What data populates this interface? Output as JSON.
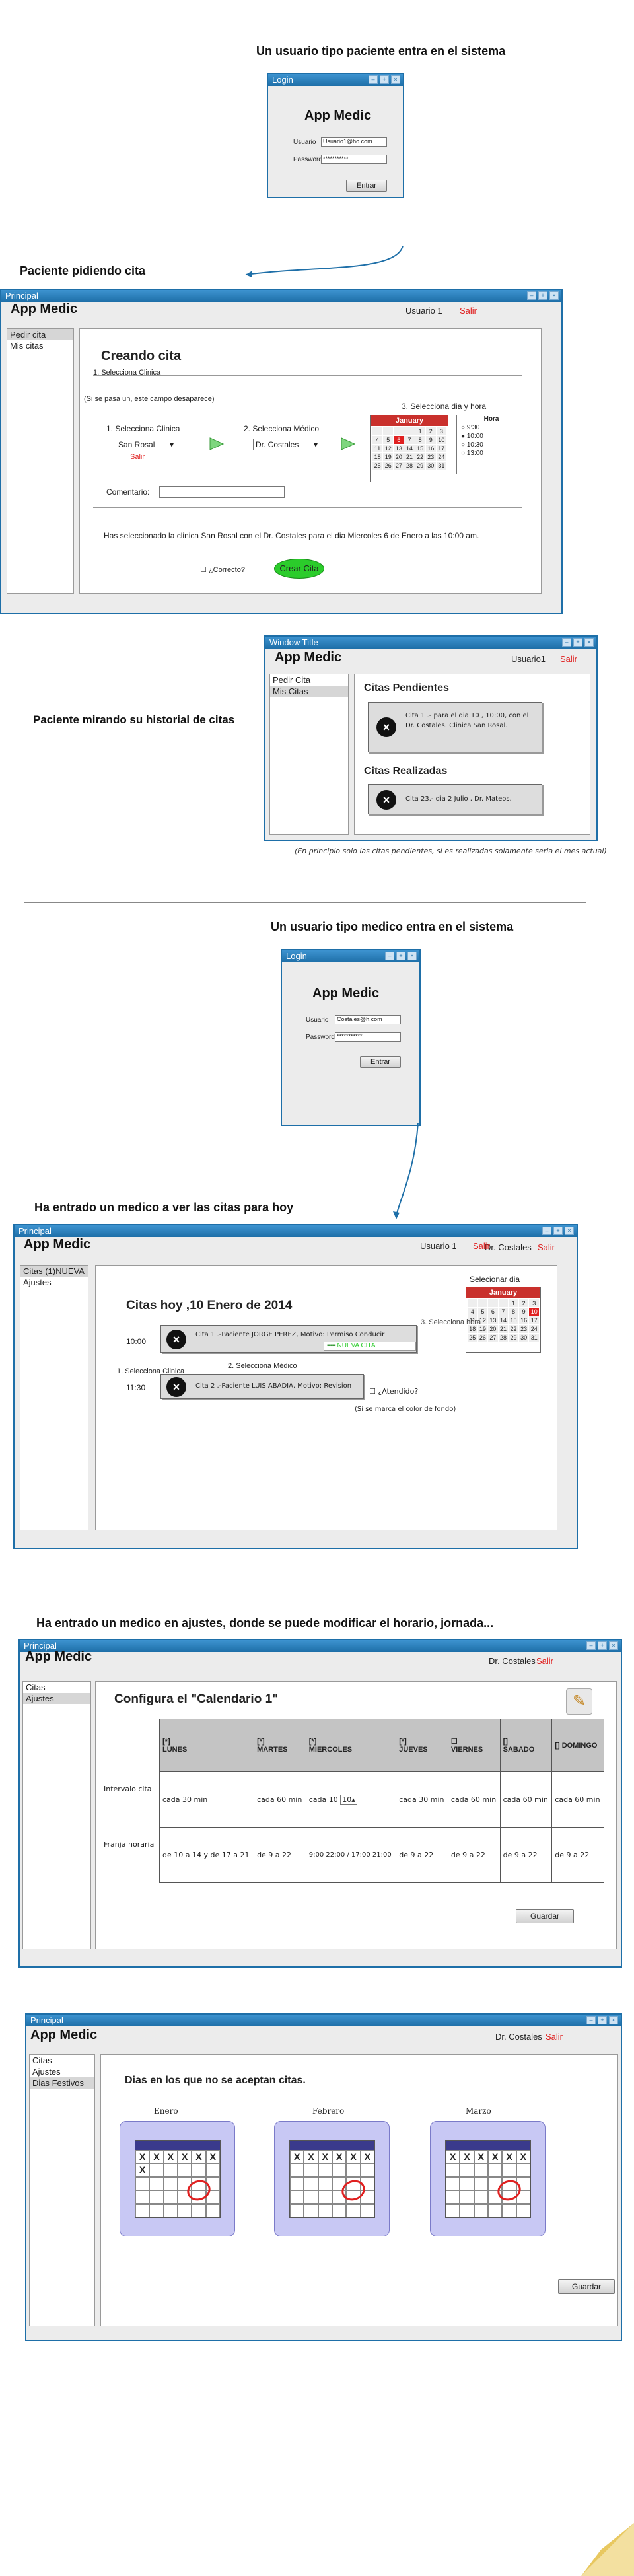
{
  "section1": {
    "heading": "Un usuario tipo paciente entra en el sistema",
    "login": {
      "title": "Login",
      "app": "App Medic",
      "user_label": "Usuario",
      "user_value": "Usuario1@ho.com",
      "pass_label": "Password",
      "pass_value": "***********",
      "button": "Entrar"
    }
  },
  "section2": {
    "heading": "Paciente pidiendo cita",
    "window_title": "Principal",
    "app": "App Medic",
    "user": "Usuario 1",
    "salir": "Salir",
    "sidebar": [
      "Pedir cita",
      "Mis citas"
    ],
    "panel_title": "Creando cita",
    "tab_label": "1. Selecciona Clinica",
    "hint": "(Si se pasa un, este campo desaparece)",
    "step1": "1. Selecciona Clinica",
    "step1_value": "San Rosal",
    "step1_note": "Salir",
    "step2": "2. Selecciona Médico",
    "step2_value": "Dr. Costales",
    "step3": "3. Selecciona dia y hora",
    "calendar_month": "January",
    "hours_header": "Hora",
    "hours": [
      "9:30",
      "10:00",
      "10:30",
      "13:00"
    ],
    "comment_label": "Comentario:",
    "summary": "Has seleccionado la clinica San Rosal con el Dr. Costales para el dia Miercoles 6 de Enero a las 10:00 am.",
    "confirm": "¿Correcto?",
    "create_button": "Crear Cita"
  },
  "section3": {
    "heading": "Paciente mirando su historial de citas",
    "window_title": "Window Title",
    "app": "App Medic",
    "user": "Usuario1",
    "salir": "Salir",
    "sidebar": [
      "Pedir Cita",
      "Mis Citas"
    ],
    "pending_title": "Citas Pendientes",
    "pending_text": "Cita 1 .- para el dia 10 , 10:00, con el Dr. Costales. Clinica San Rosal.",
    "done_title": "Citas Realizadas",
    "done_text": "Cita 23.- dia 2 Julio , Dr. Mateos.",
    "note": "(En principio solo las citas pendientes, si es realizadas solamente seria el mes actual)"
  },
  "section4": {
    "heading": "Un usuario tipo medico entra en el sistema",
    "login": {
      "title": "Login",
      "app": "App Medic",
      "user_label": "Usuario",
      "user_value": "Costales@h.com",
      "pass_label": "Password",
      "pass_value": "***********",
      "button": "Entrar"
    }
  },
  "section5": {
    "heading": "Ha entrado un medico a ver las citas para hoy",
    "window_title": "Principal",
    "app": "App Medic",
    "user": "Usuario 1",
    "user2": "Dr. Costales",
    "salir": "Salir",
    "sidebar": [
      "Citas (1)NUEVA",
      "Ajustes"
    ],
    "title": "Citas hoy ,10 Enero de 2014",
    "select_day": "Selecionar dia",
    "calendar_month": "January",
    "time1": "10:00",
    "cita1": "Cita 1 .-Paciente JORGE PEREZ, Motivo: Permiso Conducir",
    "new_label": "NUEVA CITA",
    "time2": "11:30",
    "cita2": "Cita 2 .-Paciente LUIS ABADIA, Motivo: Revision",
    "attended": "¿Atendido?",
    "color_note": "(Si se marca el color de fondo)",
    "ghost1": "2. Selecciona Médico",
    "ghost2": "1. Selecciona Clinica"
  },
  "section6": {
    "heading": "Ha entrado un medico en ajustes, donde se puede modificar el horario, jornada...",
    "window_title": "Principal",
    "app": "App Medic",
    "user": "Dr. Costales",
    "salir": "Salir",
    "sidebar": [
      "Citas",
      "Ajustes"
    ],
    "title": "Configura el \"Calendario 1\"",
    "days": [
      "LUNES",
      "MARTES",
      "MIERCOLES",
      "JUEVES",
      "VIERNES",
      "SABADO",
      "DOMINGO"
    ],
    "row1_label": "Intervalo cita",
    "row1": [
      "cada 30 min",
      "cada 60 min",
      "cada 10",
      "cada 30 min",
      "cada 60 min",
      "cada 60 min",
      "cada 60 min"
    ],
    "row2_label": "Franja horaria",
    "row2": [
      "de 10 a 14 y de 17 a 21",
      "de 9 a 22",
      "9:00 22:00 / 17:00 21:00",
      "de 9 a 22",
      "de 9 a 22",
      "de 9 a 22",
      "de 9 a 22"
    ],
    "save": "Guardar"
  },
  "section7": {
    "window_title": "Principal",
    "app": "App Medic",
    "user": "Dr. Costales",
    "salir": "Salir",
    "sidebar": [
      "Citas",
      "Ajustes",
      "Dias Festivos"
    ],
    "title": "Dias en los que no se aceptan citas.",
    "months": [
      "Enero",
      "Febrero",
      "Marzo"
    ],
    "save": "Guardar"
  }
}
